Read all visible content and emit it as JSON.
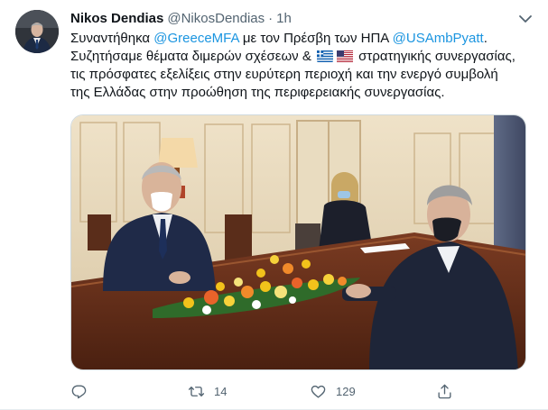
{
  "tweet": {
    "author_name": "Nikos Dendias",
    "author_handle": "@NikosDendias",
    "separator": "·",
    "time": "1h",
    "text": {
      "line1_a": "Συναντήθηκα ",
      "mention1": "@GreeceMFA",
      "line1_b": " με τον Πρέσβη των ΗΠΑ ",
      "mention2": "@USAmbPyatt",
      "line1_c": ".",
      "line2_a": "Συζητήσαμε θέματα διμερών σχέσεων & ",
      "line2_b": " στρατηγικής συνεργασίας,",
      "line3": "τις πρόσφατες εξελίξεις στην ευρύτερη περιοχή και την ενεργό συμβολή",
      "line4": "της Ελλάδας στην προώθηση της περιφερειακής συνεργασίας."
    },
    "flags": [
      "greece-flag",
      "usa-flag"
    ],
    "actions": {
      "reply_count": "",
      "retweet_count": "14",
      "like_count": "129",
      "share_count": ""
    },
    "colors": {
      "link": "#1b95e0",
      "icon": "#536471",
      "text": "#0f1419"
    }
  }
}
